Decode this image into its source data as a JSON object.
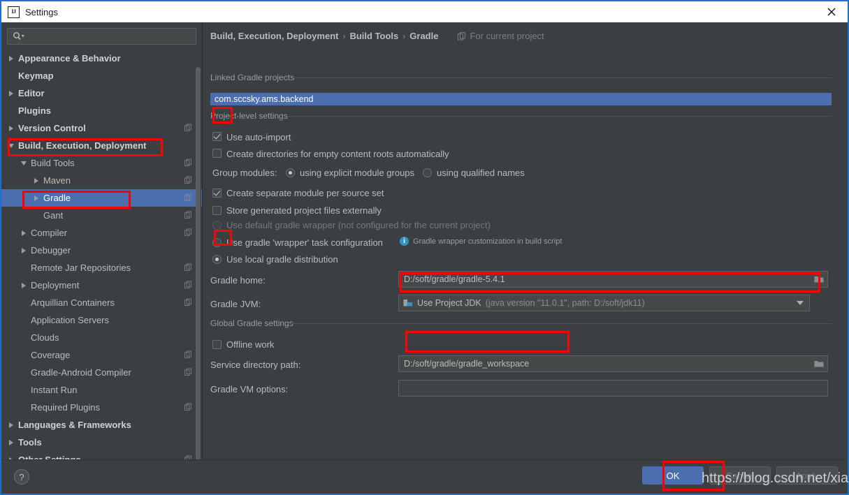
{
  "window": {
    "title": "Settings",
    "app_icon": "intellij-idea-logo",
    "close_icon": "close-icon"
  },
  "sidebar": {
    "search": {
      "placeholder": "",
      "value": "",
      "icon": "search-icon"
    },
    "items": [
      {
        "label": "Appearance & Behavior",
        "arrow": "right",
        "indent": 0,
        "bold": true,
        "copy": false,
        "selected": false
      },
      {
        "label": "Keymap",
        "arrow": "none",
        "indent": 0,
        "bold": true,
        "copy": false,
        "selected": false
      },
      {
        "label": "Editor",
        "arrow": "right",
        "indent": 0,
        "bold": true,
        "copy": false,
        "selected": false
      },
      {
        "label": "Plugins",
        "arrow": "none",
        "indent": 0,
        "bold": true,
        "copy": false,
        "selected": false
      },
      {
        "label": "Version Control",
        "arrow": "right",
        "indent": 0,
        "bold": true,
        "copy": true,
        "selected": false
      },
      {
        "label": "Build, Execution, Deployment",
        "arrow": "down",
        "indent": 0,
        "bold": true,
        "copy": false,
        "selected": false
      },
      {
        "label": "Build Tools",
        "arrow": "down",
        "indent": 1,
        "bold": false,
        "copy": true,
        "selected": false
      },
      {
        "label": "Maven",
        "arrow": "right",
        "indent": 2,
        "bold": false,
        "copy": true,
        "selected": false
      },
      {
        "label": "Gradle",
        "arrow": "right",
        "indent": 2,
        "bold": false,
        "copy": true,
        "selected": true
      },
      {
        "label": "Gant",
        "arrow": "none",
        "indent": 2,
        "bold": false,
        "copy": true,
        "selected": false
      },
      {
        "label": "Compiler",
        "arrow": "right",
        "indent": 1,
        "bold": false,
        "copy": true,
        "selected": false
      },
      {
        "label": "Debugger",
        "arrow": "right",
        "indent": 1,
        "bold": false,
        "copy": false,
        "selected": false
      },
      {
        "label": "Remote Jar Repositories",
        "arrow": "none",
        "indent": 1,
        "bold": false,
        "copy": true,
        "selected": false
      },
      {
        "label": "Deployment",
        "arrow": "right",
        "indent": 1,
        "bold": false,
        "copy": true,
        "selected": false
      },
      {
        "label": "Arquillian Containers",
        "arrow": "none",
        "indent": 1,
        "bold": false,
        "copy": true,
        "selected": false
      },
      {
        "label": "Application Servers",
        "arrow": "none",
        "indent": 1,
        "bold": false,
        "copy": false,
        "selected": false
      },
      {
        "label": "Clouds",
        "arrow": "none",
        "indent": 1,
        "bold": false,
        "copy": false,
        "selected": false
      },
      {
        "label": "Coverage",
        "arrow": "none",
        "indent": 1,
        "bold": false,
        "copy": true,
        "selected": false
      },
      {
        "label": "Gradle-Android Compiler",
        "arrow": "none",
        "indent": 1,
        "bold": false,
        "copy": true,
        "selected": false
      },
      {
        "label": "Instant Run",
        "arrow": "none",
        "indent": 1,
        "bold": false,
        "copy": false,
        "selected": false
      },
      {
        "label": "Required Plugins",
        "arrow": "none",
        "indent": 1,
        "bold": false,
        "copy": true,
        "selected": false
      },
      {
        "label": "Languages & Frameworks",
        "arrow": "right",
        "indent": 0,
        "bold": true,
        "copy": false,
        "selected": false
      },
      {
        "label": "Tools",
        "arrow": "right",
        "indent": 0,
        "bold": true,
        "copy": false,
        "selected": false
      },
      {
        "label": "Other Settings",
        "arrow": "right",
        "indent": 0,
        "bold": true,
        "copy": true,
        "selected": false
      }
    ]
  },
  "breadcrumb": {
    "segments": [
      "Build, Execution, Deployment",
      "Build Tools",
      "Gradle"
    ],
    "separator": "›",
    "scope_label": "For current project",
    "scope_icon": "project-scope-icon"
  },
  "main": {
    "linked_projects_group": "Linked Gradle projects",
    "linked_project": "com.sccsky.ams.backend",
    "project_settings_group": "Project-level settings",
    "use_auto_import": {
      "label": "Use auto-import",
      "checked": true
    },
    "create_directories": {
      "label": "Create directories for empty content roots automatically",
      "checked": false
    },
    "group_modules": {
      "label": "Group modules:",
      "option_explicit": "using explicit module groups",
      "option_qualified": "using qualified names",
      "selected": "explicit"
    },
    "create_separate_module": {
      "label": "Create separate module per source set",
      "checked": true
    },
    "store_generated": {
      "label": "Store generated project files externally",
      "checked": false
    },
    "distribution": {
      "default_wrapper": "Use default gradle wrapper (not configured for the current project)",
      "wrapper_task": "Use gradle 'wrapper' task configuration",
      "local_distribution": "Use local gradle distribution",
      "selected": "local",
      "wrapper_note": "Gradle wrapper customization in build script",
      "wrapper_note_icon": "info-icon"
    },
    "gradle_home": {
      "label": "Gradle home:",
      "value": "D:/soft/gradle/gradle-5.4.1",
      "browse_icon": "folder-icon"
    },
    "gradle_jvm": {
      "label": "Gradle JVM:",
      "value": "Use Project JDK",
      "detail": "(java version \"11.0.1\", path: D:/soft/jdk11)",
      "item_icon": "jdk-icon",
      "dropdown_icon": "chevron-down-icon",
      "more_button": "..."
    },
    "global_settings_group": "Global Gradle settings",
    "offline_work": {
      "label": "Offline work",
      "checked": false
    },
    "service_directory": {
      "label": "Service directory path:",
      "value": "D:/soft/gradle/gradle_workspace",
      "browse_icon": "folder-icon"
    },
    "gradle_vm_options": {
      "label": "Gradle VM options:",
      "value": "",
      "placeholder": ""
    }
  },
  "footer": {
    "help_label": "?",
    "ok_label": "OK",
    "cancel_label": "Cancel",
    "apply_label": "Apply"
  },
  "watermark": "https://blog.csdn.net/xiaojuge",
  "colors": {
    "background": "#3c3f41",
    "selection_blue": "#4b6eaf",
    "highlight_red": "#ff0000",
    "accent_info": "#3592c4",
    "titlebar": "#ffffff",
    "window_border": "#1c6fd4"
  }
}
